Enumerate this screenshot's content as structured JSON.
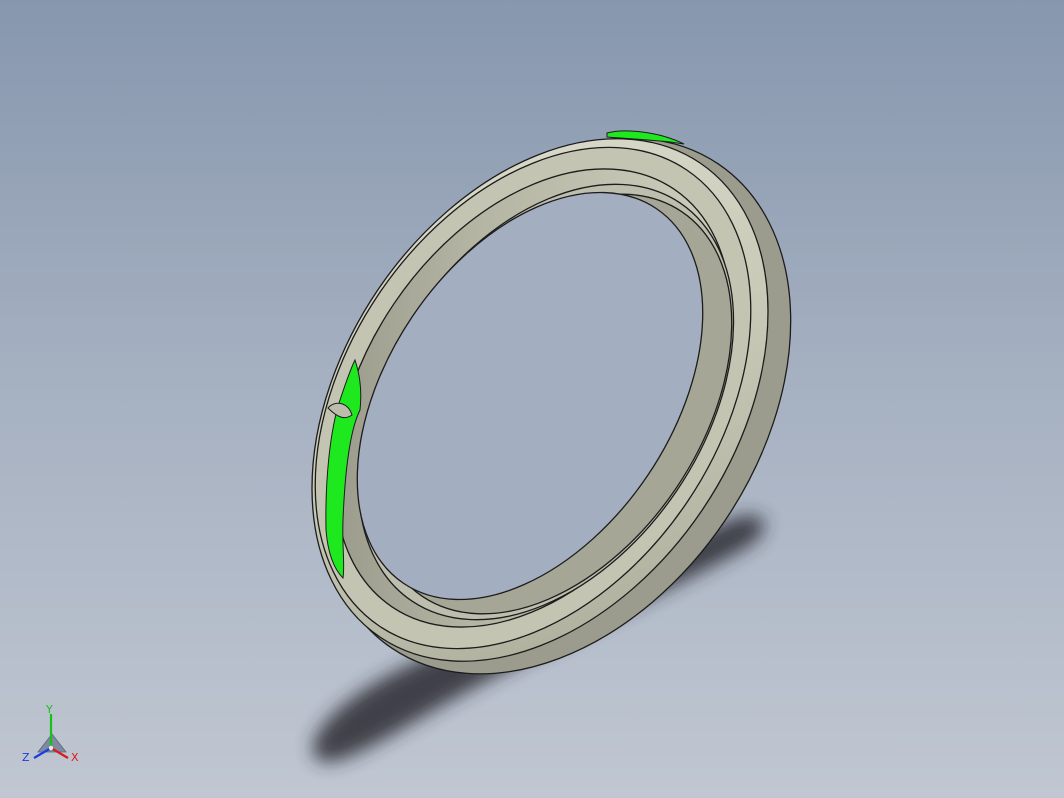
{
  "viewport": {
    "background_top": "#8797ae",
    "background_bottom": "#c0c7d2"
  },
  "model": {
    "part": "ring",
    "body_color": "#c9c9b8",
    "body_dark_color": "#8f8f82",
    "body_light_color": "#e2e2d4",
    "edge_color": "#1c1c1c",
    "selected_face_color": "#1ee81e",
    "shadow_color": "#2a2c33"
  },
  "triad": {
    "x_label": "X",
    "y_label": "Y",
    "z_label": "Z",
    "x_color": "#e01818",
    "y_color": "#18c018",
    "z_color": "#1c3ce0"
  }
}
